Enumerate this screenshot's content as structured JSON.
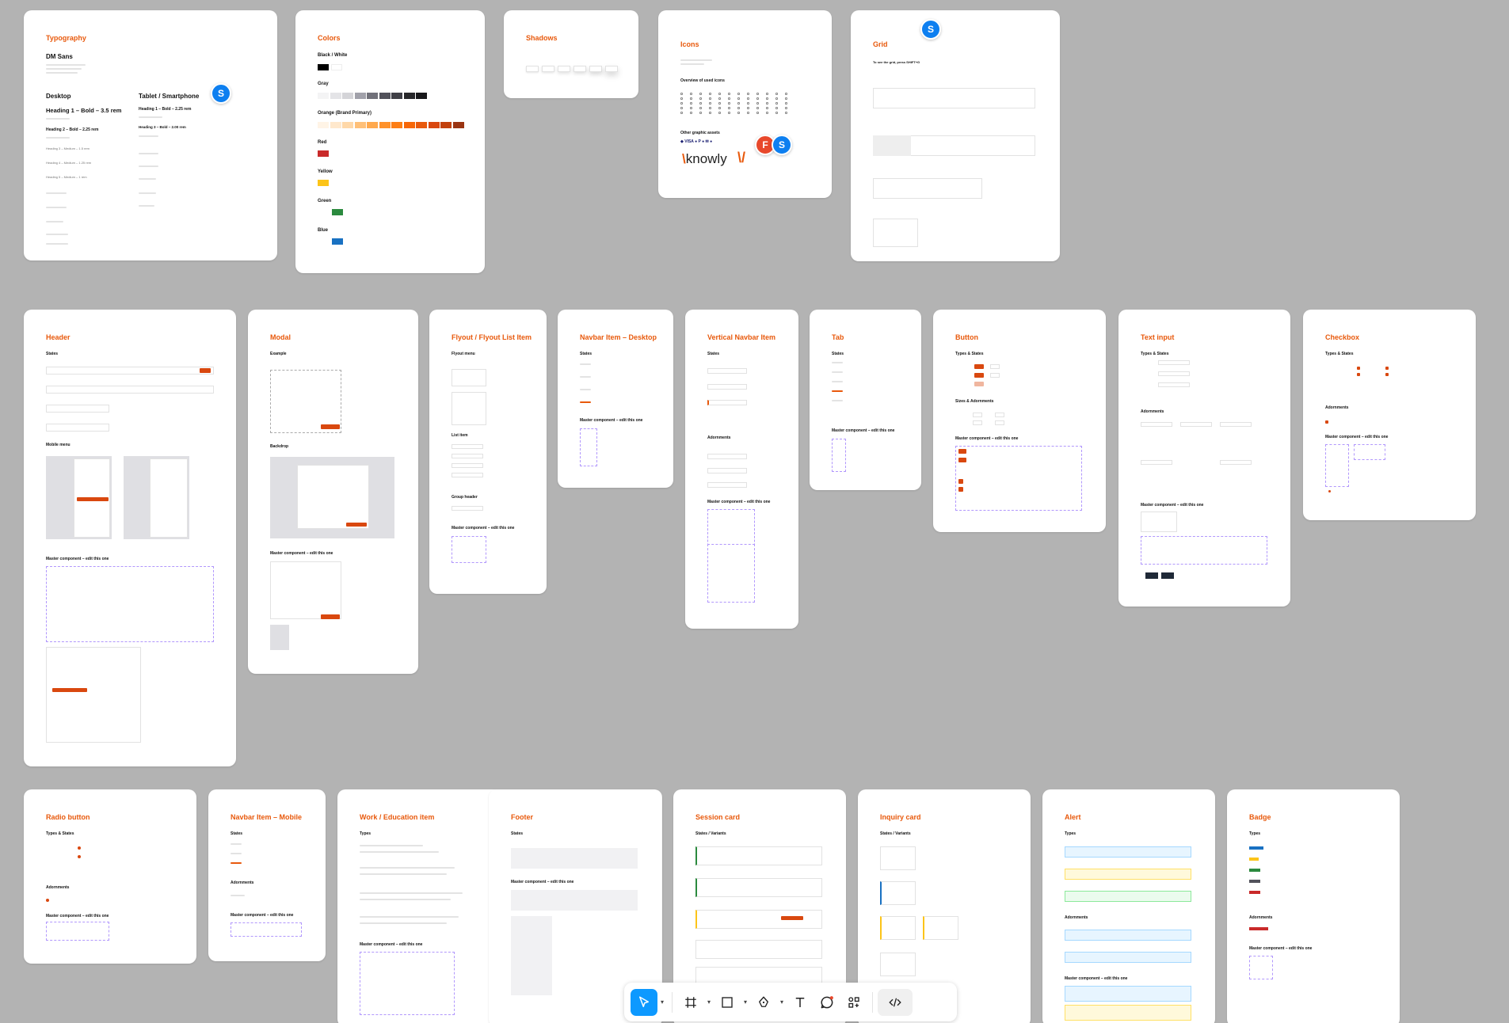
{
  "frames": {
    "typography": {
      "title": "Typography",
      "font": "DM Sans",
      "desktop": "Desktop",
      "tablet": "Tablet / Smartphone",
      "h1_desktop": "Heading 1 – Bold – 3.5 rem",
      "h2_desktop": "Heading 2 – Bold – 2.25 rem",
      "h1_tablet": "Heading 1 – Bold – 2.25 rem",
      "h3_tablet": "Heading 3 – Bold – 2.00 rem",
      "h3_desktop": "Heading 3 – Medium – 1.5 rem",
      "h4_desktop": "Heading 4 – Medium – 1.25 rem",
      "h5_desktop": "Heading 5 – Medium – 1 rem"
    },
    "colors": {
      "title": "Colors",
      "black_white": "Black / White",
      "gray": "Gray",
      "orange": "Orange (Brand Primary)",
      "red": "Red",
      "yellow": "Yellow",
      "green": "Green",
      "blue": "Blue",
      "gray_swatches": [
        "#f4f4f5",
        "#e4e4e7",
        "#d4d4d8",
        "#a1a1aa",
        "#71717a",
        "#52525b",
        "#3f3f46",
        "#27272a",
        "#18181b"
      ],
      "orange_swatches": [
        "#fff4e6",
        "#ffe8cc",
        "#ffd8a8",
        "#ffc078",
        "#ffa94d",
        "#ff922b",
        "#fd7e14",
        "#f76707",
        "#e8590c",
        "#d9480f",
        "#c2410c",
        "#9a3412"
      ],
      "red_swatch": "#c92a2a",
      "yellow_swatch": "#fcc419",
      "green_swatch": "#2b8a3e",
      "blue_swatch": "#1971c2"
    },
    "shadows": {
      "title": "Shadows"
    },
    "icons": {
      "title": "Icons",
      "overview": "Overview of used icons",
      "other": "Other graphic assets",
      "logo": "knowly"
    },
    "grid": {
      "title": "Grid",
      "hint": "To see the grid, press SHIFT+G"
    },
    "header": {
      "title": "Header",
      "states": "States",
      "mobile": "Mobile menu",
      "master": "Master component – edit this one"
    },
    "modal": {
      "title": "Modal",
      "example": "Example",
      "backdrop": "Backdrop",
      "master": "Master component – edit this one"
    },
    "flyout": {
      "title": "Flyout / Flyout List Item",
      "menu": "Flyout menu",
      "list_item": "List item",
      "group_header": "Group header",
      "master": "Master component – edit this one"
    },
    "navbar_desktop": {
      "title": "Navbar Item – Desktop",
      "states": "States",
      "master": "Master component – edit this one"
    },
    "vertical_navbar": {
      "title": "Vertical Navbar Item",
      "states": "States",
      "adornments": "Adornments",
      "master": "Master component – edit this one"
    },
    "tab": {
      "title": "Tab",
      "states": "States",
      "master": "Master component – edit this one"
    },
    "button": {
      "title": "Button",
      "types": "Types & States",
      "sizes": "Sizes & Adornments",
      "master": "Master component – edit this one"
    },
    "text_input": {
      "title": "Text input",
      "types": "Types & States",
      "adornments": "Adornments",
      "master": "Master component – edit this one"
    },
    "checkbox": {
      "title": "Checkbox",
      "types": "Types & States",
      "adornments": "Adornments",
      "master": "Master component – edit this one"
    },
    "radio": {
      "title": "Radio button",
      "types": "Types & States",
      "adornments": "Adornments",
      "master": "Master component – edit this one"
    },
    "navbar_mobile": {
      "title": "Navbar Item – Mobile",
      "states": "States",
      "adornments": "Adornments",
      "master": "Master component – edit this one"
    },
    "work": {
      "title": "Work / Education item",
      "types": "Types",
      "master": "Master component – edit this one"
    },
    "footer": {
      "title": "Footer",
      "states": "States",
      "master": "Master component – edit this one"
    },
    "session": {
      "title": "Session card",
      "states": "States / Variants"
    },
    "inquiry": {
      "title": "Inquiry card",
      "states": "States / Variants"
    },
    "alert": {
      "title": "Alert",
      "types": "Types",
      "adornments": "Adornments",
      "master": "Master component – edit this one"
    },
    "badge": {
      "title": "Badge",
      "types": "Types",
      "adornments": "Adornments",
      "master": "Master component – edit this one"
    }
  },
  "collaborators": {
    "s": "S",
    "f": "F",
    "s_color": "#0d7ff0",
    "f_color": "#e8482b"
  },
  "accent": "#e8590c",
  "toolbar": {
    "tools": [
      "move-tool",
      "frame-tool",
      "shape-tool",
      "pen-tool",
      "text-tool",
      "comment-tool",
      "actions-tool",
      "dev-mode-toggle"
    ],
    "active": "move-tool",
    "active_color": "#0d99ff"
  }
}
